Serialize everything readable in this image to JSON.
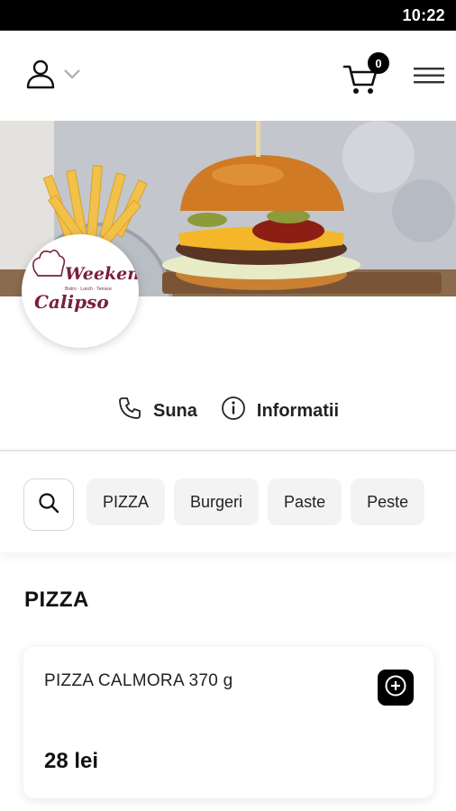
{
  "status_bar": {
    "time": "10:22"
  },
  "header": {
    "cart_count": "0"
  },
  "brand": {
    "logo_script": "Weekend",
    "logo_tagline": "Bistro · Lunch · Terrace",
    "logo_name": "Calipso"
  },
  "actions": {
    "call_label": "Suna",
    "info_label": "Informatii"
  },
  "categories": [
    "PIZZA",
    "Burgeri",
    "Paste",
    "Peste"
  ],
  "section": {
    "title": "PIZZA"
  },
  "product": {
    "name": "PIZZA CALMORA 370 g",
    "price": "28 lei"
  },
  "colors": {
    "accent": "#000000",
    "logo_maroon": "#7a1f3d",
    "chip_bg": "#f3f3f3"
  }
}
